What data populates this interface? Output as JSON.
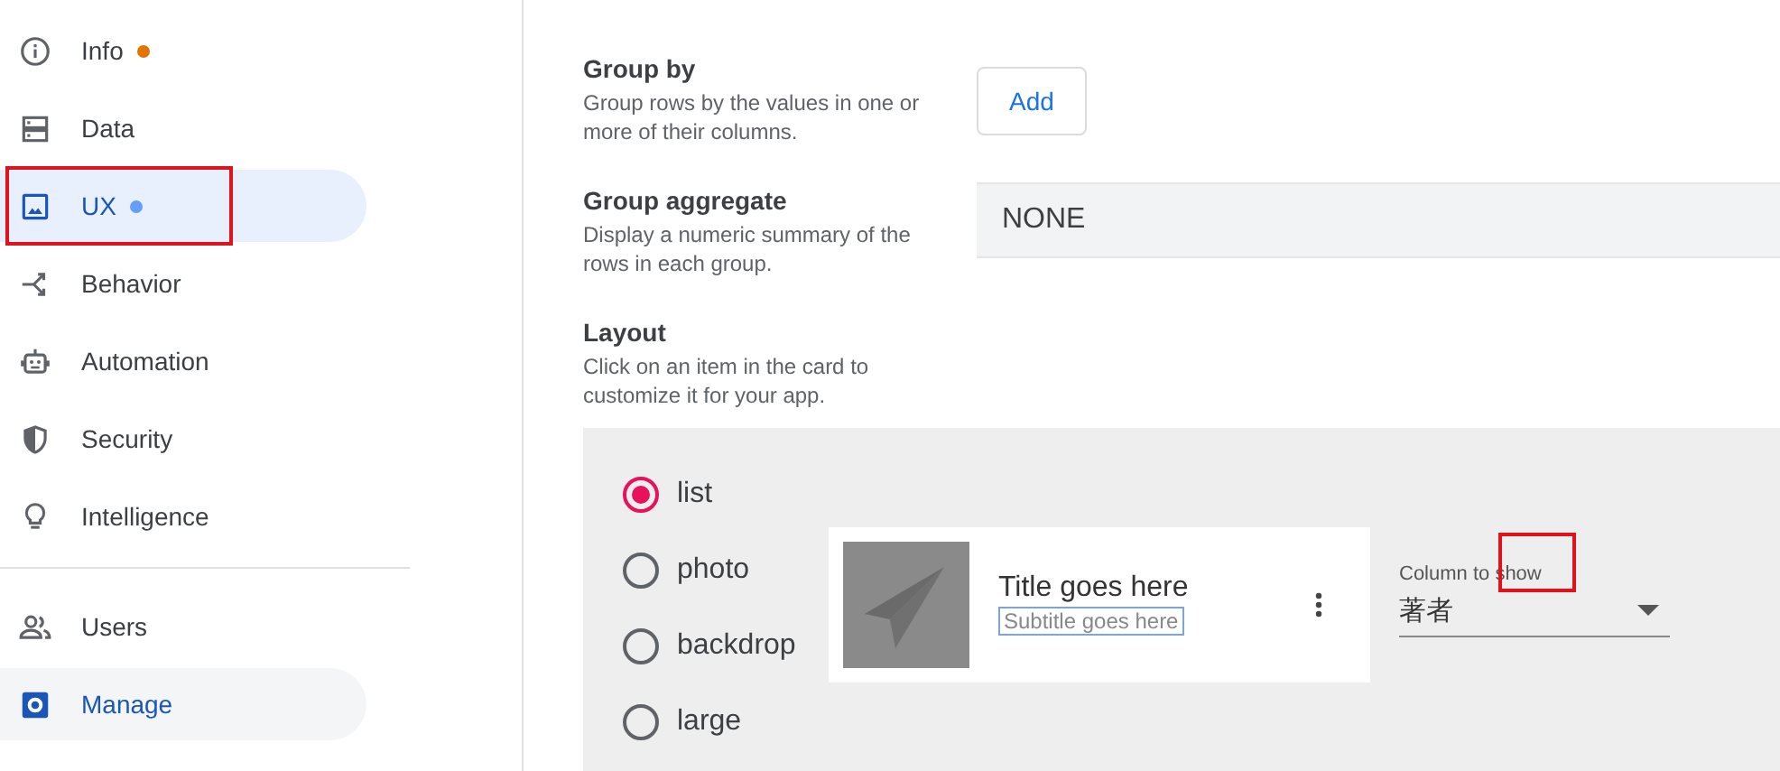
{
  "sidebar": {
    "items": [
      {
        "kind": "info",
        "label": "Info",
        "selected": false,
        "highlighted": false,
        "color": "#e37400"
      },
      {
        "kind": "data",
        "label": "Data",
        "selected": false,
        "highlighted": false
      },
      {
        "kind": "ux",
        "label": "UX",
        "selected": true,
        "highlighted": false,
        "color": "#669df6"
      },
      {
        "kind": "behavior",
        "label": "Behavior",
        "selected": false,
        "highlighted": false
      },
      {
        "kind": "automation",
        "label": "Automation",
        "selected": false,
        "highlighted": false
      },
      {
        "kind": "security",
        "label": "Security",
        "selected": false,
        "highlighted": false
      },
      {
        "kind": "intelligence",
        "label": "Intelligence",
        "selected": false,
        "highlighted": false
      },
      {
        "kind": "divider"
      },
      {
        "kind": "users",
        "label": "Users",
        "selected": false,
        "highlighted": false
      },
      {
        "kind": "manage",
        "label": "Manage",
        "selected": false,
        "highlighted": true
      }
    ]
  },
  "settings": [
    {
      "kind": "button",
      "title": "Group by",
      "description": "Group rows by the values in one or more of their columns.",
      "button": "Add"
    },
    {
      "kind": "select",
      "title": "Group aggregate",
      "description": "Display a numeric summary of the rows in each group.",
      "value": "NONE"
    },
    {
      "kind": "layout",
      "title": "Layout",
      "description": "Click on an item in the card to customize it for your app."
    }
  ],
  "layout": {
    "options": [
      {
        "label": "list",
        "selected": true
      },
      {
        "label": "photo",
        "selected": false
      },
      {
        "label": "backdrop",
        "selected": false
      },
      {
        "label": "large",
        "selected": false
      }
    ],
    "card": {
      "title": "Title goes here",
      "subtitle": "Subtitle goes here"
    },
    "column_to_show": {
      "label": "Column to show",
      "value": "著者"
    }
  }
}
